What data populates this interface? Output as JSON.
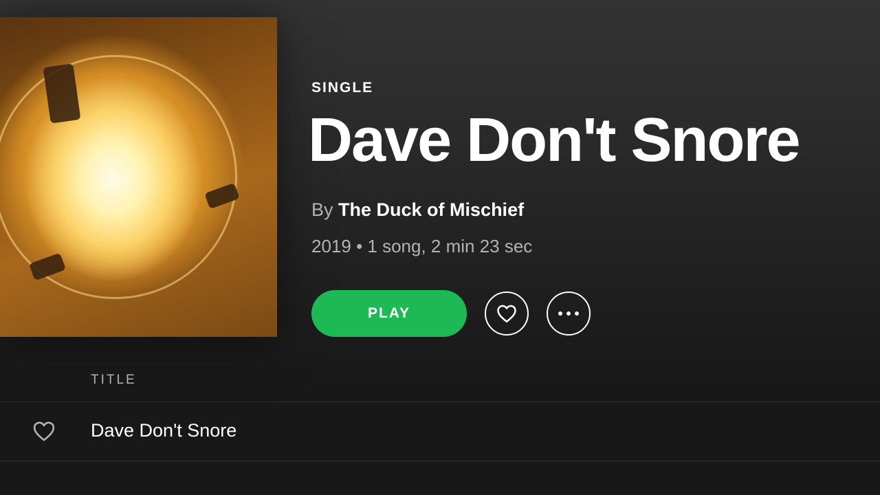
{
  "album": {
    "type_label": "SINGLE",
    "title": "Dave Don't Snore",
    "by_prefix": "By",
    "artist": "The Duck of Mischief",
    "meta": "2019 • 1 song, 2 min 23 sec"
  },
  "controls": {
    "play_label": "PLAY",
    "like_icon": "heart-outline-icon",
    "more_icon": "ellipsis-icon"
  },
  "tracklist": {
    "columns": [
      "TITLE"
    ],
    "tracks": [
      {
        "title": "Dave Don't Snore"
      }
    ]
  },
  "colors": {
    "accent": "#1db954",
    "background": "#181818",
    "secondary_text": "#b3b3b3"
  }
}
